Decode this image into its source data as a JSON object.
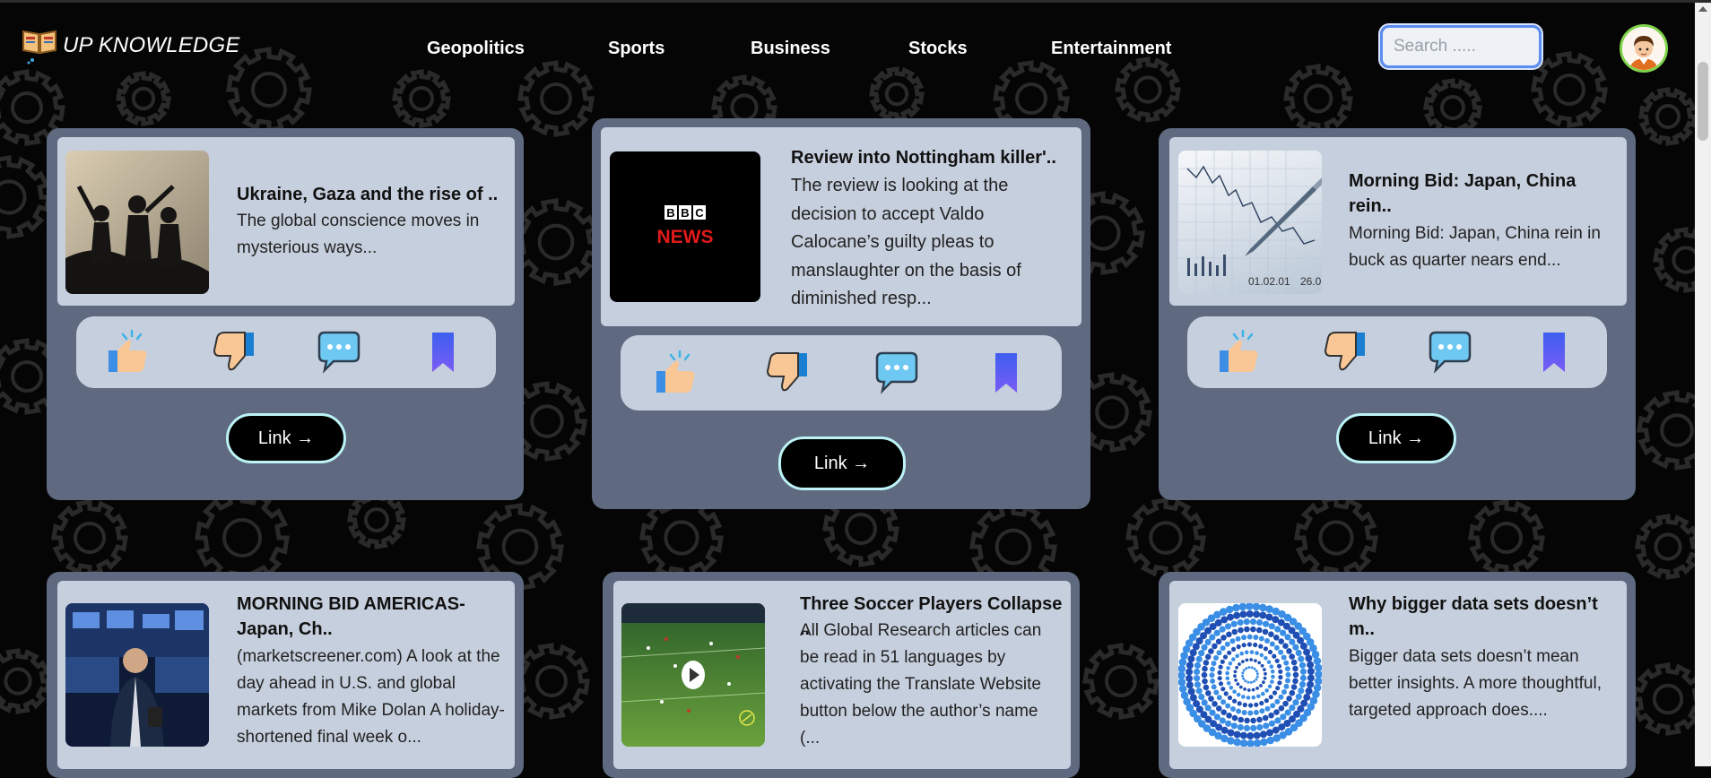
{
  "app": {
    "title": "UP KNOWLEDGE"
  },
  "nav": {
    "items": [
      "Geopolitics",
      "Sports",
      "Business",
      "Stocks",
      "Entertainment"
    ]
  },
  "search": {
    "placeholder": "Search ....."
  },
  "colors": {
    "background": "#050505",
    "card_outer": "#5f6a80",
    "card_inner": "#c6cfdd",
    "link_border": "#bdf3f6",
    "avatar_ring": "#7fd34a",
    "search_border": "#5b8df0"
  },
  "icons": {
    "like": "thumbs-up-icon",
    "dislike": "thumbs-down-icon",
    "comment": "comment-icon",
    "bookmark": "bookmark-icon"
  },
  "cards": [
    {
      "title": "Ukraine, Gaza and the rise of ..",
      "desc": "The global conscience moves in mysterious ways...",
      "link_label": "Link →",
      "image": "silhouette-figures"
    },
    {
      "title": "Review into Nottingham killer'..",
      "desc": "The review is looking at the decision to accept Valdo Calocane’s guilty pleas to manslaughter on the basis of diminished resp...",
      "link_label": "Link →",
      "image": "bbc-news-logo",
      "image_text": [
        "B",
        "B",
        "C",
        "NEWS"
      ]
    },
    {
      "title": "Morning Bid: Japan, China rein..",
      "desc": "Morning Bid: Japan, China rein in buck as quarter nears end...",
      "link_label": "Link →",
      "image": "stock-chart-pen",
      "image_text": [
        "01.02.01",
        "26.0"
      ]
    },
    {
      "title": "MORNING BID AMERICAS-Japan, Ch..",
      "desc": "(marketscreener.com) A look at the day ahead in U.S. and global markets from Mike Dolan A holiday-shortened final week o...",
      "image": "stock-trader"
    },
    {
      "title": "Three Soccer Players Collapse ..",
      "desc": "All Global Research articles can be read in 51 languages by activating the Translate Website button below the author’s name (...",
      "image": "soccer-video"
    },
    {
      "title": "Why bigger data sets doesn’t m..",
      "desc": "Bigger data sets doesn’t mean better insights. A more thoughtful, targeted approach does....",
      "image": "data-spiral"
    }
  ]
}
